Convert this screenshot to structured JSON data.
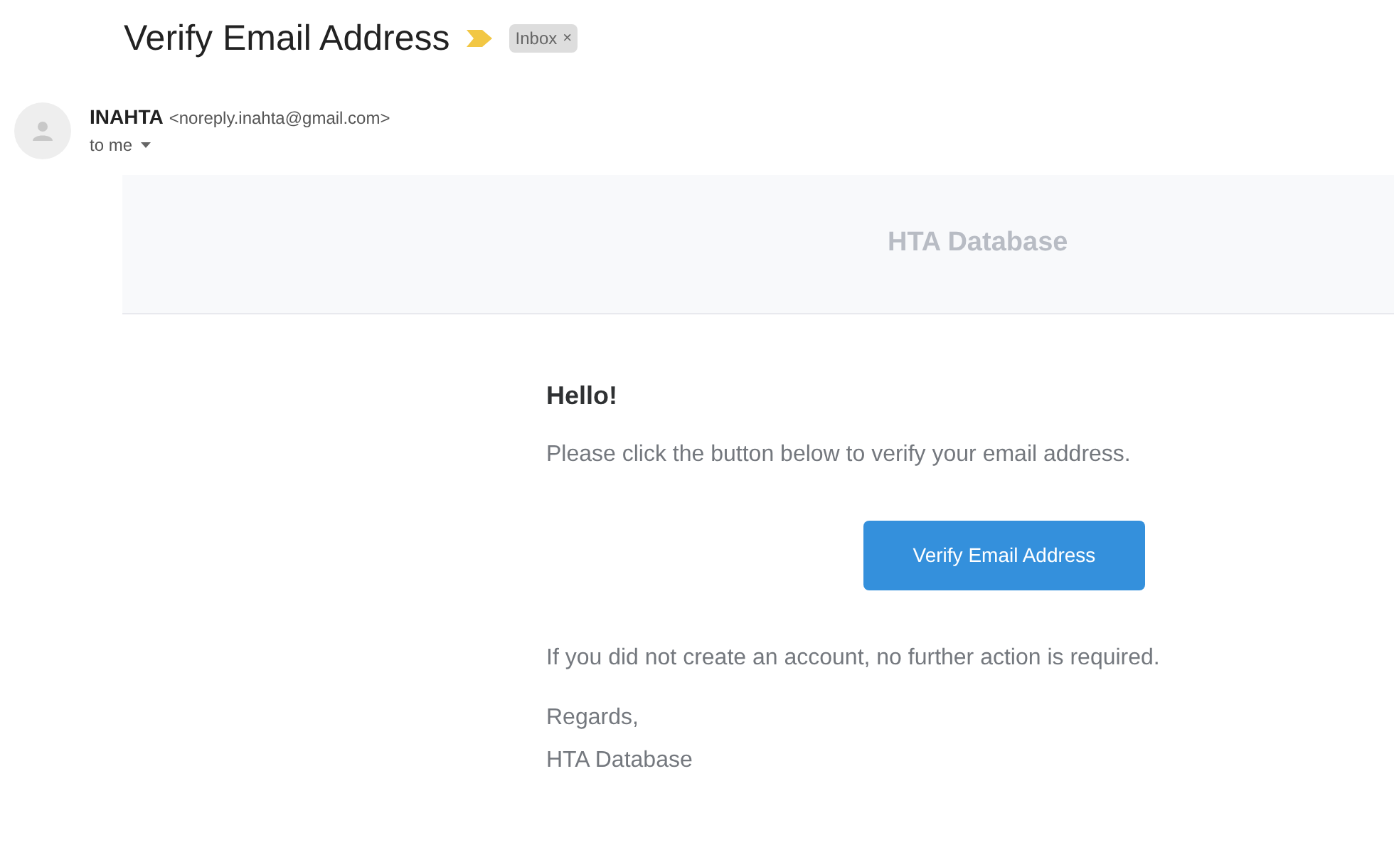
{
  "subject": "Verify Email Address",
  "label": {
    "text": "Inbox",
    "remove": "×"
  },
  "important": true,
  "sender": {
    "name": "INAHTA",
    "email": "<noreply.inahta@gmail.com>",
    "recipient": "to me"
  },
  "email": {
    "header": "HTA Database",
    "greeting": "Hello!",
    "intro": "Please click the button below to verify your email address.",
    "button": "Verify Email Address",
    "outro": "If you did not create an account, no further action is required.",
    "salutation": "Regards,",
    "signature": "HTA Database"
  }
}
